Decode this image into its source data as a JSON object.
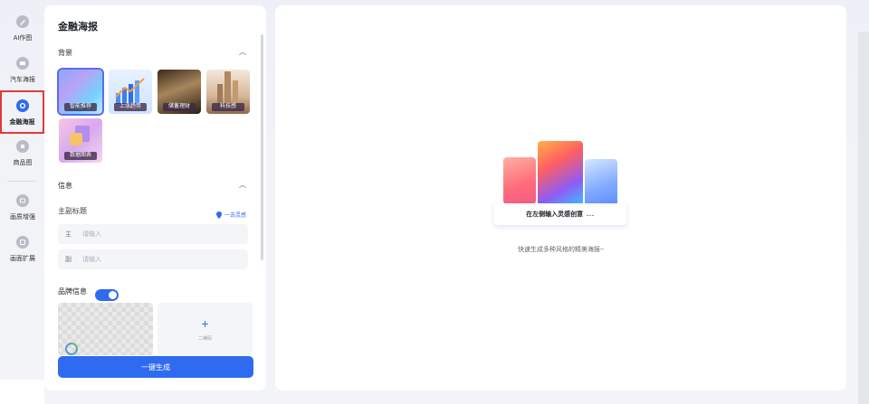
{
  "rail": {
    "items": [
      {
        "label": "AI作图",
        "icon": "ai-drawing-icon"
      },
      {
        "label": "汽车海报",
        "icon": "car-poster-icon"
      },
      {
        "label": "金融海报",
        "icon": "finance-poster-icon",
        "active": true
      },
      {
        "label": "商品图",
        "icon": "product-image-icon"
      },
      {
        "label": "画质增强",
        "icon": "quality-enhance-icon"
      },
      {
        "label": "画面扩展",
        "icon": "image-expand-icon"
      }
    ]
  },
  "panel": {
    "title": "金融海报",
    "background_section": "背景",
    "thumbnails": [
      {
        "label": "智能推荐",
        "selected": true
      },
      {
        "label": "上涨趋势"
      },
      {
        "label": "储蓄理财"
      },
      {
        "label": "科技感"
      },
      {
        "label": "数据图表"
      }
    ],
    "info_section": "信息",
    "title_label": "主副标题",
    "inspire_link": "一去灵感",
    "main_prefix": "主",
    "main_placeholder": "请输入",
    "sub_prefix": "副",
    "sub_placeholder": "请输入",
    "brand_label": "品牌信息",
    "brand_enabled": true,
    "upload_hint": "二维码",
    "generate_button": "一键生成"
  },
  "canvas": {
    "hint": "在左侧输入灵感创意",
    "dots": "...",
    "subtitle": "快速生成多种风格的精美海报~"
  },
  "colors": {
    "accent": "#2f6bf0",
    "highlight": "#e53935"
  }
}
